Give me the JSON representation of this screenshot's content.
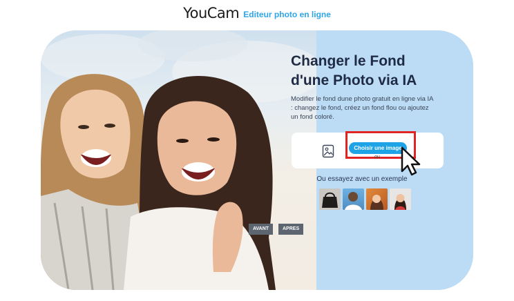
{
  "header": {
    "logo": "YouCam",
    "tagline": "Editeur photo en ligne"
  },
  "hero": {
    "title": "Changer le Fond d'une Photo via IA",
    "description": "Modifier le fond dune photo gratuit en ligne via IA : changez le fond, créez un fond flou ou ajoutez un fond coloré."
  },
  "upload": {
    "choose_label": "Choisir une image",
    "or_label": "ou"
  },
  "examples": {
    "label": "Ou essayez avec un exemple",
    "thumbnails": [
      "handbag",
      "person-blue-sky",
      "person-autumn",
      "person-portrait"
    ]
  },
  "compare": {
    "before_label": "AVANT",
    "after_label": "APRES"
  },
  "colors": {
    "accent": "#1ea4e6",
    "panel": "#bcdcf5",
    "highlight": "#e02424",
    "title": "#1f2a44"
  },
  "icons": [
    "image-upload-icon",
    "cursor-arrow-icon"
  ]
}
